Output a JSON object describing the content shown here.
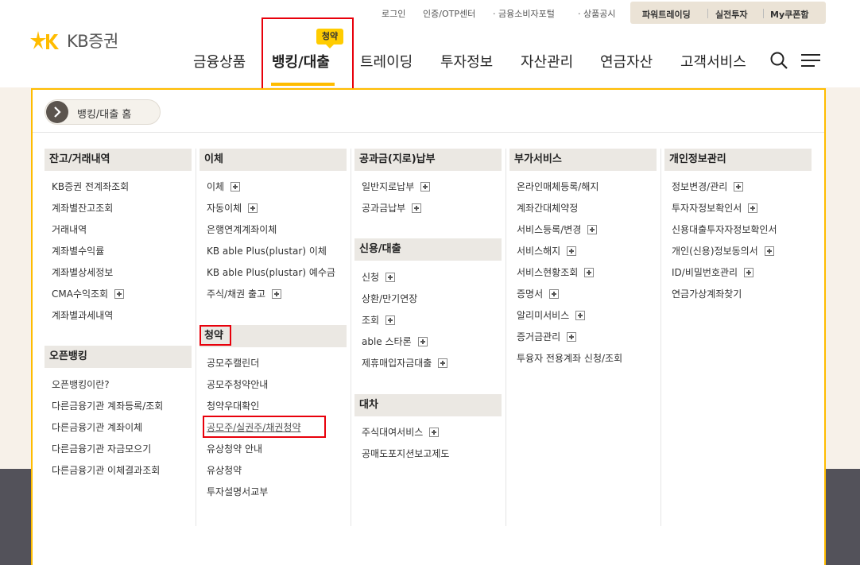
{
  "header": {
    "logo_text": "KB증권",
    "util_links": [
      "로그인",
      "인증/OTP센터",
      "· 금융소비자포털",
      "· 상품공시"
    ],
    "util_box": [
      "파워트레이딩",
      "실전투자",
      "My쿠폰함"
    ],
    "gnb": [
      "금융상품",
      "뱅킹/대출",
      "트레이딩",
      "투자정보",
      "자산관리",
      "연금자산",
      "고객서비스"
    ],
    "badge": "청약"
  },
  "panel": {
    "home_label": "뱅킹/대출 홈",
    "columns": [
      {
        "sections": [
          {
            "title": "잔고/거래내역",
            "items": [
              {
                "label": "KB증권 전계좌조회",
                "plus": false
              },
              {
                "label": "계좌별잔고조회",
                "plus": false
              },
              {
                "label": "거래내역",
                "plus": false
              },
              {
                "label": "계좌별수익률",
                "plus": false
              },
              {
                "label": "계좌별상세정보",
                "plus": false
              },
              {
                "label": "CMA수익조회",
                "plus": true
              },
              {
                "label": "계좌별과세내역",
                "plus": false
              }
            ]
          },
          {
            "title": "오픈뱅킹",
            "items": [
              {
                "label": "오픈뱅킹이란?",
                "plus": false
              },
              {
                "label": "다른금융기관 계좌등록/조회",
                "plus": false
              },
              {
                "label": "다른금융기관 계좌이체",
                "plus": false
              },
              {
                "label": "다른금융기관 자금모으기",
                "plus": false
              },
              {
                "label": "다른금융기관 이체결과조회",
                "plus": false
              }
            ]
          }
        ]
      },
      {
        "sections": [
          {
            "title": "이체",
            "items": [
              {
                "label": "이체",
                "plus": true
              },
              {
                "label": "자동이체",
                "plus": true
              },
              {
                "label": "은행연계계좌이체",
                "plus": false
              },
              {
                "label": "KB able Plus(plustar) 이체",
                "plus": false
              },
              {
                "label": "KB able Plus(plustar) 예수금",
                "plus": false
              },
              {
                "label": "주식/채권 출고",
                "plus": true
              }
            ]
          },
          {
            "title": "청약",
            "items": [
              {
                "label": "공모주캘린더",
                "plus": false
              },
              {
                "label": "공모주청약안내",
                "plus": false
              },
              {
                "label": "청약우대확인",
                "plus": false
              },
              {
                "label": "공모주/실권주/채권청약",
                "plus": false
              },
              {
                "label": "유상청약 안내",
                "plus": false
              },
              {
                "label": "유상청약",
                "plus": false
              },
              {
                "label": "투자설명서교부",
                "plus": false
              }
            ]
          }
        ]
      },
      {
        "sections": [
          {
            "title": "공과금(지로)납부",
            "items": [
              {
                "label": "일반지로납부",
                "plus": true
              },
              {
                "label": "공과금납부",
                "plus": true
              }
            ]
          },
          {
            "title": "신용/대출",
            "items": [
              {
                "label": "신청",
                "plus": true
              },
              {
                "label": "상환/만기연장",
                "plus": false
              },
              {
                "label": "조회",
                "plus": true
              },
              {
                "label": "able 스타론",
                "plus": true
              },
              {
                "label": "제휴매입자금대출",
                "plus": true
              }
            ]
          },
          {
            "title": "대차",
            "items": [
              {
                "label": "주식대여서비스",
                "plus": true
              },
              {
                "label": "공매도포지션보고제도",
                "plus": false
              }
            ]
          }
        ]
      },
      {
        "sections": [
          {
            "title": "부가서비스",
            "items": [
              {
                "label": "온라인매체등록/해지",
                "plus": false
              },
              {
                "label": "계좌간대체약정",
                "plus": false
              },
              {
                "label": "서비스등록/변경",
                "plus": true
              },
              {
                "label": "서비스해지",
                "plus": true
              },
              {
                "label": "서비스현황조회",
                "plus": true
              },
              {
                "label": "증명서",
                "plus": true
              },
              {
                "label": "알리미서비스",
                "plus": true
              },
              {
                "label": "증거금관리",
                "plus": true
              },
              {
                "label": "투융자 전용계좌 신청/조회",
                "plus": false
              }
            ]
          }
        ]
      },
      {
        "sections": [
          {
            "title": "개인정보관리",
            "items": [
              {
                "label": "정보변경/관리",
                "plus": true
              },
              {
                "label": "투자자정보확인서",
                "plus": true
              },
              {
                "label": "신용대출투자자정보확인서",
                "plus": false
              },
              {
                "label": "개인(신용)정보동의서",
                "plus": true
              },
              {
                "label": "ID/비밀번호관리",
                "plus": true
              },
              {
                "label": "연금가상계좌찾기",
                "plus": false
              }
            ]
          }
        ]
      }
    ]
  },
  "colors": {
    "accent": "#ffbc00",
    "highlight": "#e8000b",
    "panel_border": "#ffbc00"
  }
}
